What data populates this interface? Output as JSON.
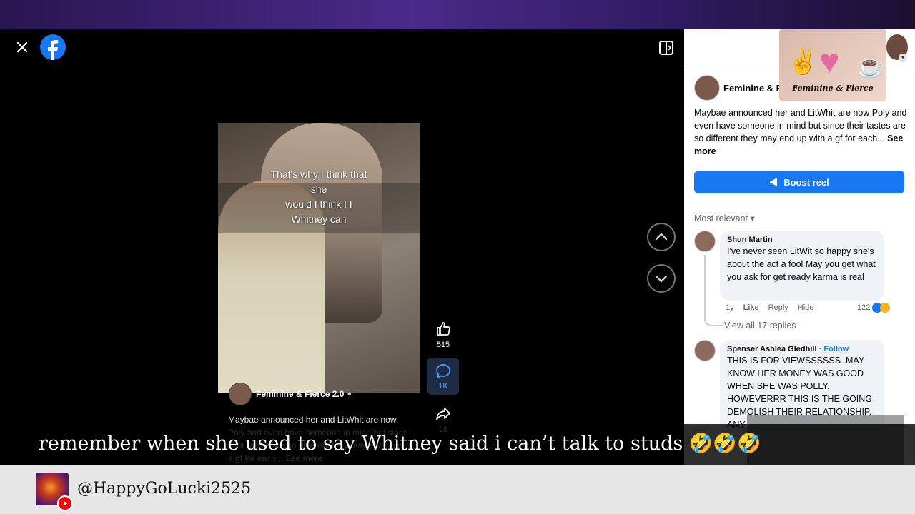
{
  "viewer": {
    "video_caption_lines": [
      "That's why I think that",
      "she",
      "would I think I I",
      "Whitney can"
    ],
    "author_name": "Feminine & Fierce 2.0",
    "author_badge": "●",
    "video_description": "Maybae announced her and LitWhit are now Poly and even have someone in mind but since their tastes are so different they may end up with a gf for each... See more",
    "actions": {
      "like_count": "515",
      "comment_count": "1K",
      "share_count": "28"
    }
  },
  "sidebar": {
    "header_art_text": "Feminine & Fierce",
    "page_name": "Feminine & F",
    "post_text": "Maybae announced her and LitWhit are now Poly and even have someone in mind but since their tastes are so different they may end up with a gf for each...",
    "see_more": "See more",
    "boost_label": "Boost reel",
    "sort_label": "Most relevant",
    "comments": [
      {
        "name": "Shun Martin",
        "text": "I've never seen LitWit so happy she's about the act a fool May you get what you ask for get ready karma is real",
        "time": "1y",
        "like": "Like",
        "reply": "Reply",
        "hide": "Hide",
        "reactions": "122",
        "view_replies": "View all 17 replies"
      },
      {
        "name": "Spenser Ashlea Gledhill",
        "follow": "Follow",
        "text": "THIS IS FOR VIEWSSSSSS. MAY KNOW HER MONEY WAS GOOD WHEN SHE WAS POLLY. HOWEVERRR THIS IS THE GOING DEMOLISH THEIR RELATIONSHIP. ANY"
      }
    ]
  },
  "caption": {
    "text": "remember when she used to say Whitney said i can’t talk to studs 🤣🤣🤣"
  },
  "footer": {
    "handle": "@HappyGoLucki2525"
  },
  "colors": {
    "facebook_blue": "#1877f2",
    "youtube_red": "#ff0000"
  }
}
